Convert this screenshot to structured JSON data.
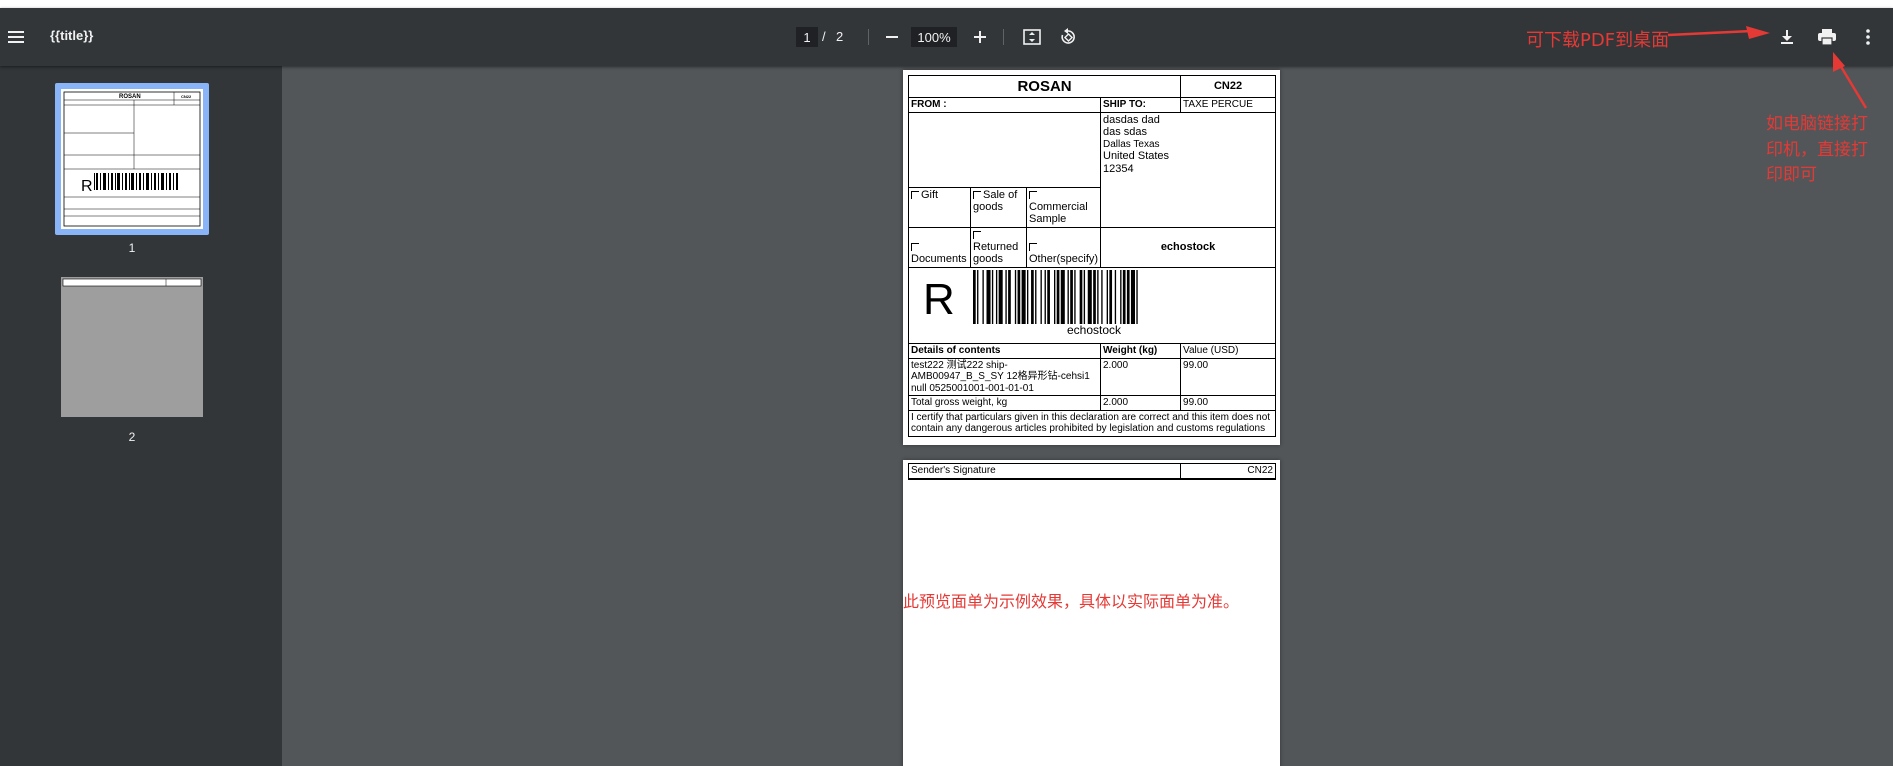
{
  "toolbar": {
    "title": "{{title}}",
    "page_current": "1",
    "page_separator": "/",
    "page_total": "2",
    "zoom": "100%",
    "icons": [
      "menu-icon",
      "zoom-out-icon",
      "zoom-in-icon",
      "fit-page-icon",
      "rotate-icon",
      "download-icon",
      "print-icon",
      "more-vert-icon"
    ]
  },
  "sidebar": {
    "thumbnails": [
      {
        "label": "1",
        "selected": true
      },
      {
        "label": "2",
        "selected": false
      }
    ]
  },
  "page1": {
    "brand": "ROSAN",
    "form_code": "CN22",
    "from_label": "FROM :",
    "ship_to_label": "SHIP TO:",
    "ship_to_name": "TAXE PERCUE",
    "address_line1": "dasdas dad",
    "address_line2": "das sdas",
    "address_line3": "Dallas Texas",
    "address_line4": "United States",
    "address_line5": "12354",
    "cat_gift": "Gift",
    "cat_sale": "Sale of goods",
    "cat_commercial": "Commercial Sample",
    "cat_documents": "Documents",
    "cat_returned": "Returned goods",
    "cat_other": "Other(specify)",
    "shop_name": "echostock",
    "big_letter": "R",
    "barcode_caption": "echostock",
    "contents_header": "Details of contents",
    "weight_header": "Weight (kg)",
    "value_header": "Value (USD)",
    "item_description": "test222 测试222 ship-AMB00947_B_S_SY 12格异形钻-cehsi1 null 0525001001-001-01-01",
    "item_weight": "2.000",
    "item_value": "99.00",
    "total_label": "Total gross weight, kg",
    "total_weight": "2.000",
    "total_value": "99.00",
    "certification": "I certify that particulars given in this declaration are correct and this item does not contain any dangerous articles prohibited by legislation and customs regulations"
  },
  "page2": {
    "signature_label": "Sender's Signature",
    "form_code": "CN22"
  },
  "annotations": {
    "download_note": "可下载PDF到桌面",
    "print_note": "如电脑链接打印机，直接打印即可",
    "preview_note": "此预览面单为示例效果，具体以实际面单为准。"
  },
  "colors": {
    "toolbar_bg": "#323639",
    "viewer_bg": "#525659",
    "annotation_red": "#e53935",
    "thumbnail_selected": "#8ab4f8"
  }
}
